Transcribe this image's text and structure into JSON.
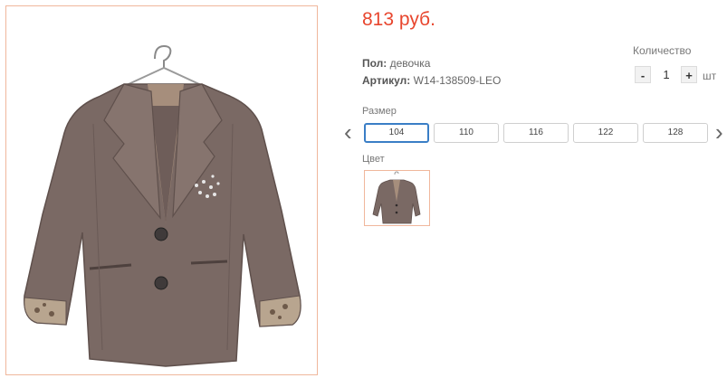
{
  "product": {
    "price": "813 руб.",
    "gender_label": "Пол:",
    "gender_value": "девочка",
    "article_label": "Артикул:",
    "article_value": "W14-138509-LEO"
  },
  "quantity": {
    "label": "Количество",
    "minus": "-",
    "value": "1",
    "plus": "+",
    "unit": "шт"
  },
  "sizes": {
    "label": "Размер",
    "prev_arrow": "‹",
    "next_arrow": "›",
    "items": [
      "104",
      "110",
      "116",
      "122",
      "128"
    ],
    "selected": "104"
  },
  "colors": {
    "label": "Цвет",
    "items": [
      {
        "name": "jacket-swatch",
        "color": "#7a6964"
      }
    ]
  },
  "palette": {
    "price": "#e8462e",
    "selected_border": "#3a7ec6",
    "frame_border": "#f0b79c",
    "jacket": "#7a6964"
  }
}
